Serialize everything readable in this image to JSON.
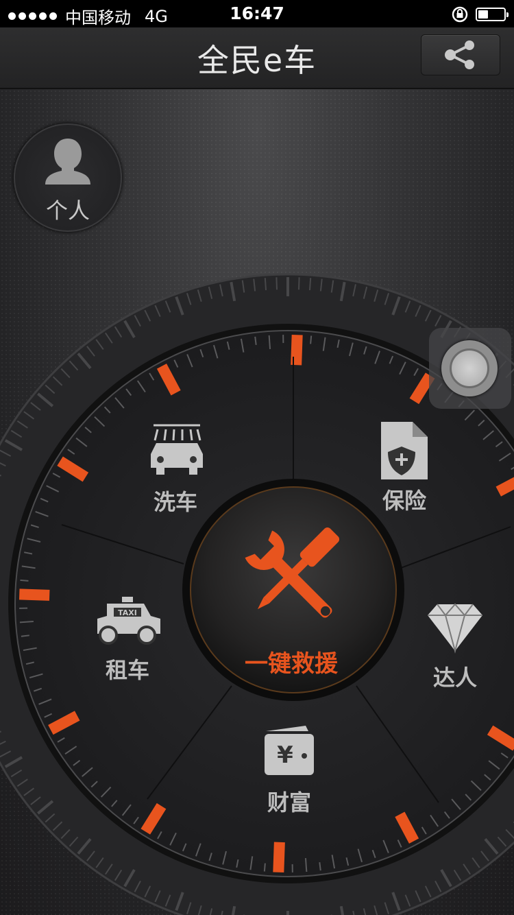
{
  "status_bar": {
    "carrier": "中国移动",
    "network": "4G",
    "time": "16:47"
  },
  "nav": {
    "title": "全民e车",
    "share_icon": "share-icon"
  },
  "profile": {
    "label": "个人",
    "icon": "user-icon"
  },
  "dial": {
    "center": {
      "label": "一键救援",
      "icon": "wrench-screwdriver-icon"
    },
    "items": [
      {
        "label": "洗车",
        "icon": "car-wash-icon"
      },
      {
        "label": "保险",
        "icon": "insurance-document-icon"
      },
      {
        "label": "达人",
        "icon": "diamond-icon"
      },
      {
        "label": "财富",
        "icon": "wallet-icon"
      },
      {
        "label": "租车",
        "icon": "taxi-icon"
      }
    ],
    "taxi_sign": "TAXI",
    "currency_symbol": "¥"
  },
  "floating_button": {
    "icon": "assistive-touch-icon"
  },
  "colors": {
    "accent": "#e8541e",
    "background": "#2b2b2d"
  }
}
